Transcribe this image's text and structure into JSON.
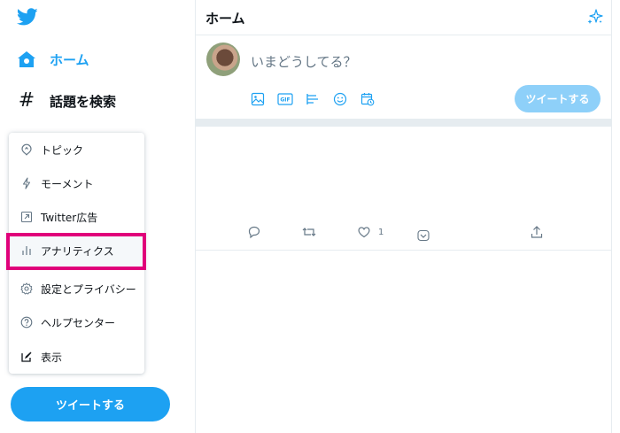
{
  "colors": {
    "accent": "#1da1f2",
    "accent_disabled": "#8ed0f9",
    "highlight": "#e0007a",
    "text": "#0f1419",
    "muted": "#657786"
  },
  "logo": {
    "icon": "twitter-bird-icon"
  },
  "nav": {
    "home": {
      "label": "ホーム",
      "icon": "home-icon"
    },
    "explore": {
      "label": "話題を検索",
      "icon": "hashtag-icon"
    }
  },
  "menu": {
    "items": [
      {
        "label": "トピック",
        "icon": "topic-icon"
      },
      {
        "label": "モーメント",
        "icon": "lightning-icon"
      },
      {
        "label": "Twitter広告",
        "icon": "external-link-icon"
      },
      {
        "label": "アナリティクス",
        "icon": "bar-chart-icon"
      },
      {
        "label": "設定とプライバシー",
        "icon": "gear-icon"
      },
      {
        "label": "ヘルプセンター",
        "icon": "help-icon"
      },
      {
        "label": "表示",
        "icon": "edit-icon"
      }
    ]
  },
  "sidebar_tweet_button": "ツイートする",
  "header": {
    "title": "ホーム"
  },
  "compose": {
    "placeholder": "いまどうしてる？",
    "tools": [
      "image-icon",
      "gif-icon",
      "poll-icon",
      "emoji-icon",
      "schedule-icon"
    ],
    "gif_label": "GIF",
    "button": "ツイートする"
  },
  "tweet_actions": {
    "like_count": "1"
  }
}
